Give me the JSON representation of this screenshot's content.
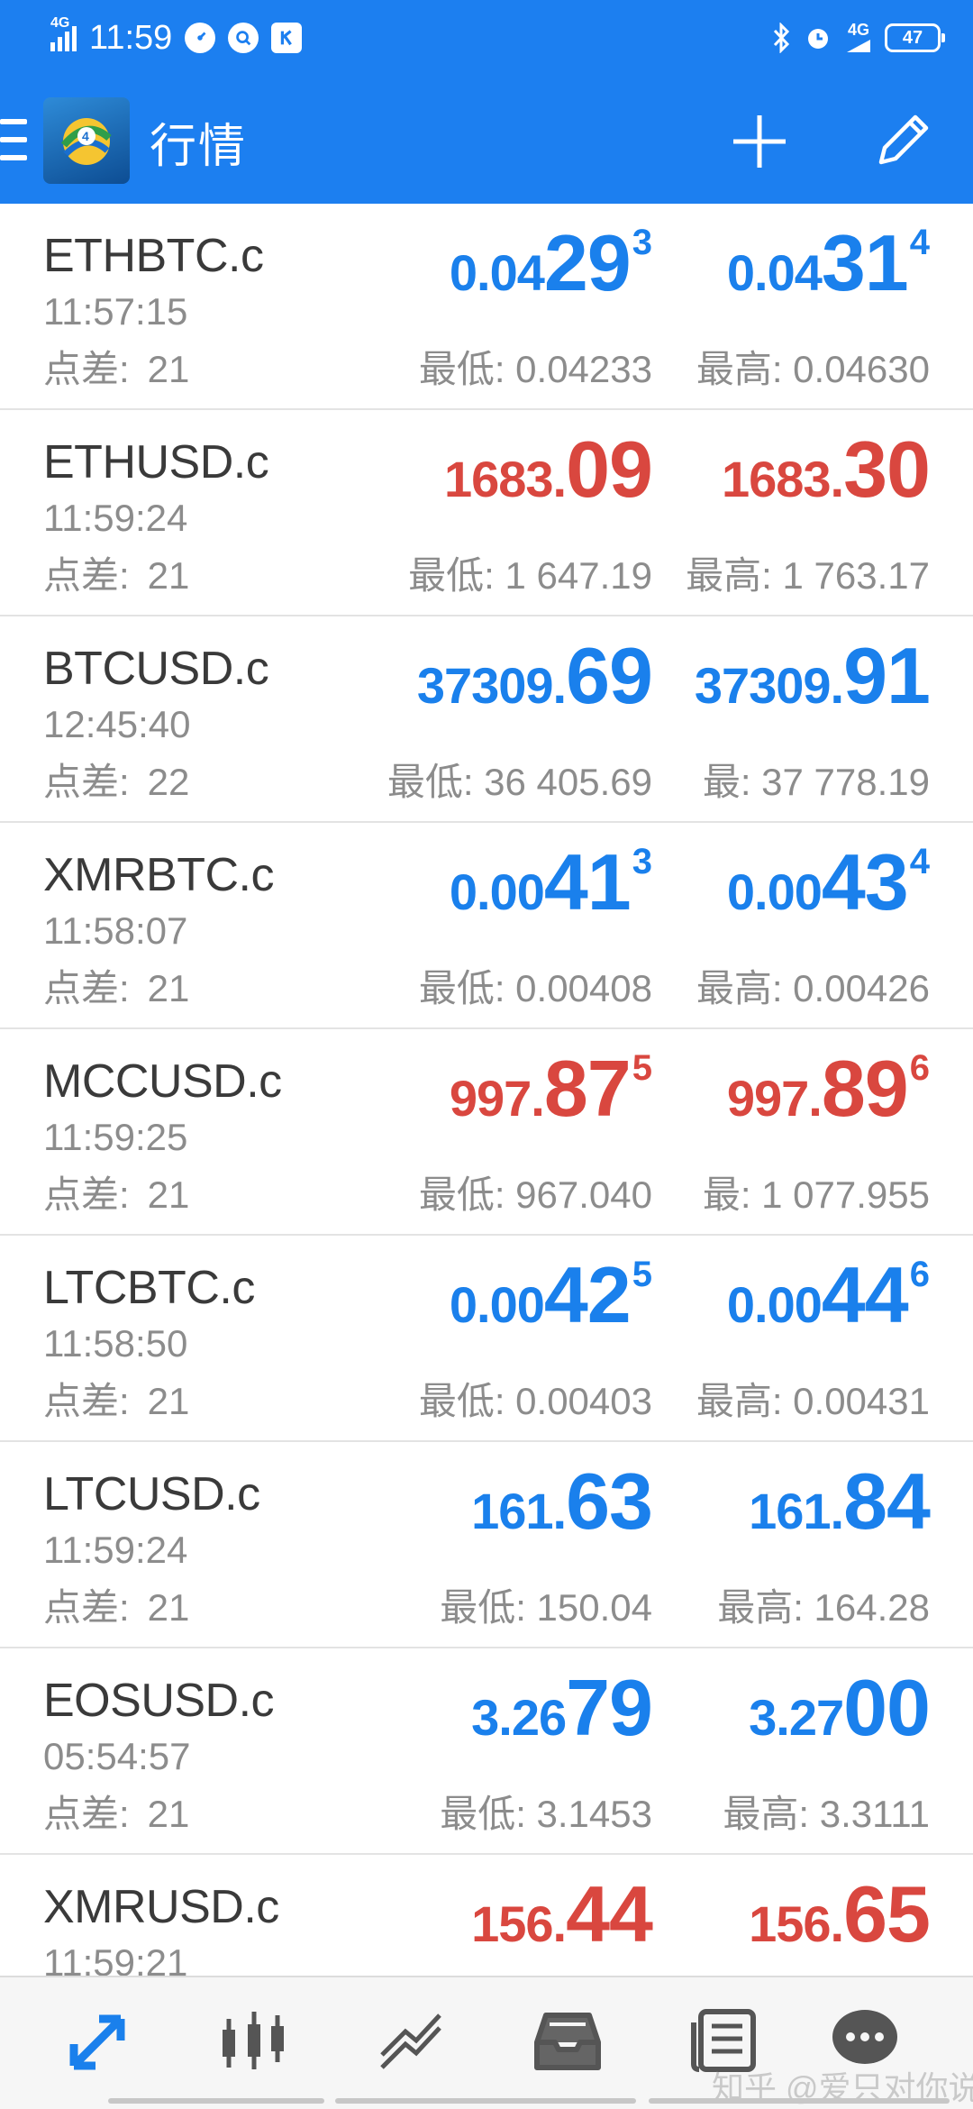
{
  "status_bar": {
    "time": "11:59",
    "network_left": "4G",
    "network_right": "4G",
    "battery": "47"
  },
  "app_bar": {
    "title": "行情"
  },
  "quotes": [
    {
      "symbol": "ETHBTC.c",
      "time": "11:57:15",
      "spread_label": "点差:",
      "spread": "21",
      "bid": {
        "small": "0.04",
        "big": "29",
        "sup": "3",
        "color": "blue"
      },
      "ask": {
        "small": "0.04",
        "big": "31",
        "sup": "4",
        "color": "blue"
      },
      "low": "最低: 0.04233",
      "high": "最高: 0.04630"
    },
    {
      "symbol": "ETHUSD.c",
      "time": "11:59:24",
      "spread_label": "点差:",
      "spread": "21",
      "bid": {
        "small": "1683.",
        "big": "09",
        "sup": "",
        "color": "red"
      },
      "ask": {
        "small": "1683.",
        "big": "30",
        "sup": "",
        "color": "red"
      },
      "low": "最低: 1 647.19",
      "high": "最高: 1 763.17"
    },
    {
      "symbol": "BTCUSD.c",
      "time": "12:45:40",
      "spread_label": "点差:",
      "spread": "22",
      "bid": {
        "small": "37309.",
        "big": "69",
        "sup": "",
        "color": "blue"
      },
      "ask": {
        "small": "37309.",
        "big": "91",
        "sup": "",
        "color": "blue"
      },
      "low": "最低: 36 405.69",
      "high": "最: 37 778.19"
    },
    {
      "symbol": "XMRBTC.c",
      "time": "11:58:07",
      "spread_label": "点差:",
      "spread": "21",
      "bid": {
        "small": "0.00",
        "big": "41",
        "sup": "3",
        "color": "blue"
      },
      "ask": {
        "small": "0.00",
        "big": "43",
        "sup": "4",
        "color": "blue"
      },
      "low": "最低: 0.00408",
      "high": "最高: 0.00426"
    },
    {
      "symbol": "MCCUSD.c",
      "time": "11:59:25",
      "spread_label": "点差:",
      "spread": "21",
      "bid": {
        "small": "997.",
        "big": "87",
        "sup": "5",
        "color": "red"
      },
      "ask": {
        "small": "997.",
        "big": "89",
        "sup": "6",
        "color": "red"
      },
      "low": "最低: 967.040",
      "high": "最: 1 077.955"
    },
    {
      "symbol": "LTCBTC.c",
      "time": "11:58:50",
      "spread_label": "点差:",
      "spread": "21",
      "bid": {
        "small": "0.00",
        "big": "42",
        "sup": "5",
        "color": "blue"
      },
      "ask": {
        "small": "0.00",
        "big": "44",
        "sup": "6",
        "color": "blue"
      },
      "low": "最低: 0.00403",
      "high": "最高: 0.00431"
    },
    {
      "symbol": "LTCUSD.c",
      "time": "11:59:24",
      "spread_label": "点差:",
      "spread": "21",
      "bid": {
        "small": "161.",
        "big": "63",
        "sup": "",
        "color": "blue"
      },
      "ask": {
        "small": "161.",
        "big": "84",
        "sup": "",
        "color": "blue"
      },
      "low": "最低: 150.04",
      "high": "最高: 164.28"
    },
    {
      "symbol": "EOSUSD.c",
      "time": "05:54:57",
      "spread_label": "点差:",
      "spread": "21",
      "bid": {
        "small": "3.26",
        "big": "79",
        "sup": "",
        "color": "blue"
      },
      "ask": {
        "small": "3.27",
        "big": "00",
        "sup": "",
        "color": "blue"
      },
      "low": "最低: 3.1453",
      "high": "最高: 3.3111"
    },
    {
      "symbol": "XMRUSD.c",
      "time": "11:59:21",
      "spread_label": "点差:",
      "spread": "21",
      "bid": {
        "small": "156.",
        "big": "44",
        "sup": "",
        "color": "red"
      },
      "ask": {
        "small": "156.",
        "big": "65",
        "sup": "",
        "color": "red"
      },
      "low": "",
      "high": ""
    }
  ],
  "bottom_nav": {
    "items": [
      "quotes-icon",
      "chart-icon",
      "trade-icon",
      "history-icon",
      "news-icon",
      "messages-icon"
    ],
    "watermark": "知乎 @爱只对你说"
  },
  "colors": {
    "accent": "#1c7ff0",
    "price_up": "#1a80ec",
    "price_down": "#d9473f"
  }
}
